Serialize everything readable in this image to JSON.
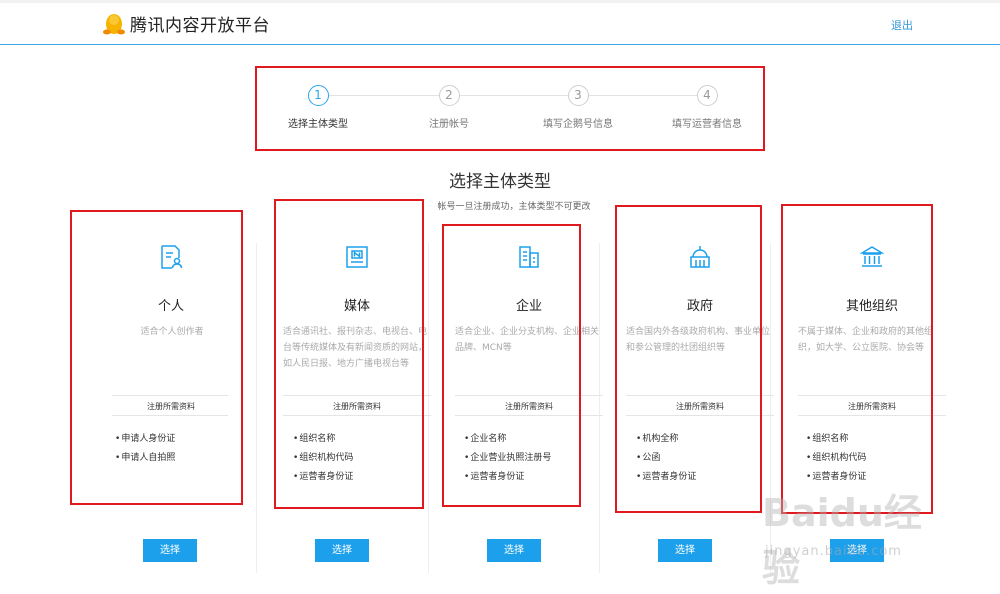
{
  "header": {
    "title": "腾讯内容开放平台",
    "logout_label": "退出"
  },
  "steps": [
    {
      "number": "1",
      "label": "选择主体类型",
      "active": true
    },
    {
      "number": "2",
      "label": "注册帐号",
      "active": false
    },
    {
      "number": "3",
      "label": "填写企鹅号信息",
      "active": false
    },
    {
      "number": "4",
      "label": "填写运营者信息",
      "active": false
    }
  ],
  "main": {
    "title": "选择主体类型",
    "subtitle": "帐号一旦注册成功，主体类型不可更改"
  },
  "cards": [
    {
      "icon": "person-document-icon",
      "name": "个人",
      "desc": "适合个人创作者",
      "req_title": "注册所需资料",
      "requirements": [
        "申请人身份证",
        "申请人自拍照"
      ],
      "button": "选择"
    },
    {
      "icon": "newspaper-icon",
      "name": "媒体",
      "desc": "适合通讯社、报刊杂志、电视台、电台等传统媒体及有新闻资质的网站，如人民日报、地方广播电视台等",
      "req_title": "注册所需资料",
      "requirements": [
        "组织名称",
        "组织机构代码",
        "运营者身份证"
      ],
      "button": "选择"
    },
    {
      "icon": "building-icon",
      "name": "企业",
      "desc": "适合企业、企业分支机构、企业相关品牌、MCN等",
      "req_title": "注册所需资料",
      "requirements": [
        "企业名称",
        "企业营业执照注册号",
        "运营者身份证"
      ],
      "button": "选择"
    },
    {
      "icon": "government-dome-icon",
      "name": "政府",
      "desc": "适合国内外各级政府机构、事业单位和参公管理的社团组织等",
      "req_title": "注册所需资料",
      "requirements": [
        "机构全称",
        "公函",
        "运营者身份证"
      ],
      "button": "选择"
    },
    {
      "icon": "institution-pillars-icon",
      "name": "其他组织",
      "desc": "不属于媒体、企业和政府的其他组织，如大学、公立医院、协会等",
      "req_title": "注册所需资料",
      "requirements": [
        "组织名称",
        "组织机构代码",
        "运营者身份证"
      ],
      "button": "选择"
    }
  ],
  "watermark": {
    "text": "Baidu经验",
    "url": "jingyan.baidu.com"
  },
  "colors": {
    "accent": "#1da0ec",
    "highlight_box": "#e0191e",
    "header_border": "#3aa6e8"
  }
}
